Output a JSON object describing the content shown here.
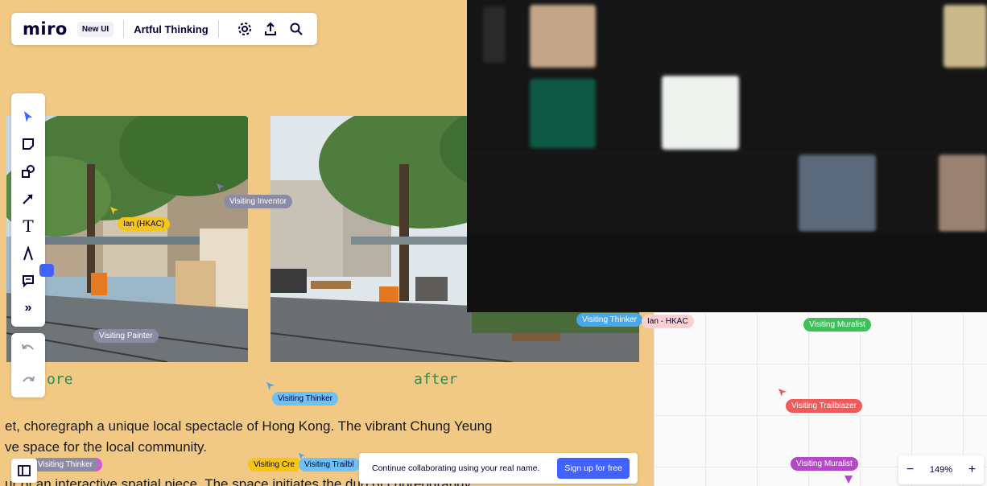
{
  "topbar": {
    "logo": "miro",
    "badge": "New UI",
    "board_name": "Artful Thinking",
    "settings_icon": "gear-icon",
    "export_icon": "upload-icon",
    "search_icon": "search-icon"
  },
  "tools": {
    "items": [
      "select-icon",
      "sticky-note-icon",
      "shapes-icon",
      "connector-icon",
      "text-icon",
      "pen-icon",
      "comment-icon",
      "more-icon"
    ],
    "text_glyph": "T",
    "more_glyph": "»",
    "undo_icon": "undo-icon",
    "redo_icon": "redo-icon"
  },
  "captions": {
    "before": "ore",
    "after": "after"
  },
  "body_text": {
    "line1": "et, choregraph a unique local spectacle of Hong Kong. The vibrant Chung Yeung",
    "line2": "ve space for the local community.",
    "line3": "ur of an interactive spatial piece. The space initiates the duo of choreography ..."
  },
  "cursors": {
    "visiting_inventor": "Visiting Inventor",
    "ian_hkac": "Ian (HKAC)",
    "visiting_painter": "Visiting Painter",
    "visiting_thinker": "Visiting Thinker",
    "visiting_thinker_right": "Visiting Thinker",
    "ian_hkac_right": "Ian - HKAC",
    "visiting_muralist_green": "Visiting Muralist",
    "visiting_trailblazer": "Visiting Trailblazer",
    "visiting_muralist_purple": "Visiting Muralist",
    "bottom_thinker": "Visiting Thinker",
    "bottom_er": "er",
    "bottom_creator": "Visiting Cre",
    "bottom_trailblazer": "Visiting Trailbl"
  },
  "banner": {
    "text": "Continue collaborating using your real name.",
    "button": "Sign up for free"
  },
  "zoom": {
    "minus": "−",
    "level": "149%",
    "plus": "+"
  },
  "colors": {
    "board_bg": "#f1c984",
    "brand": "#050038",
    "signup_blue": "#4262ff",
    "video_bg": "#151515"
  }
}
